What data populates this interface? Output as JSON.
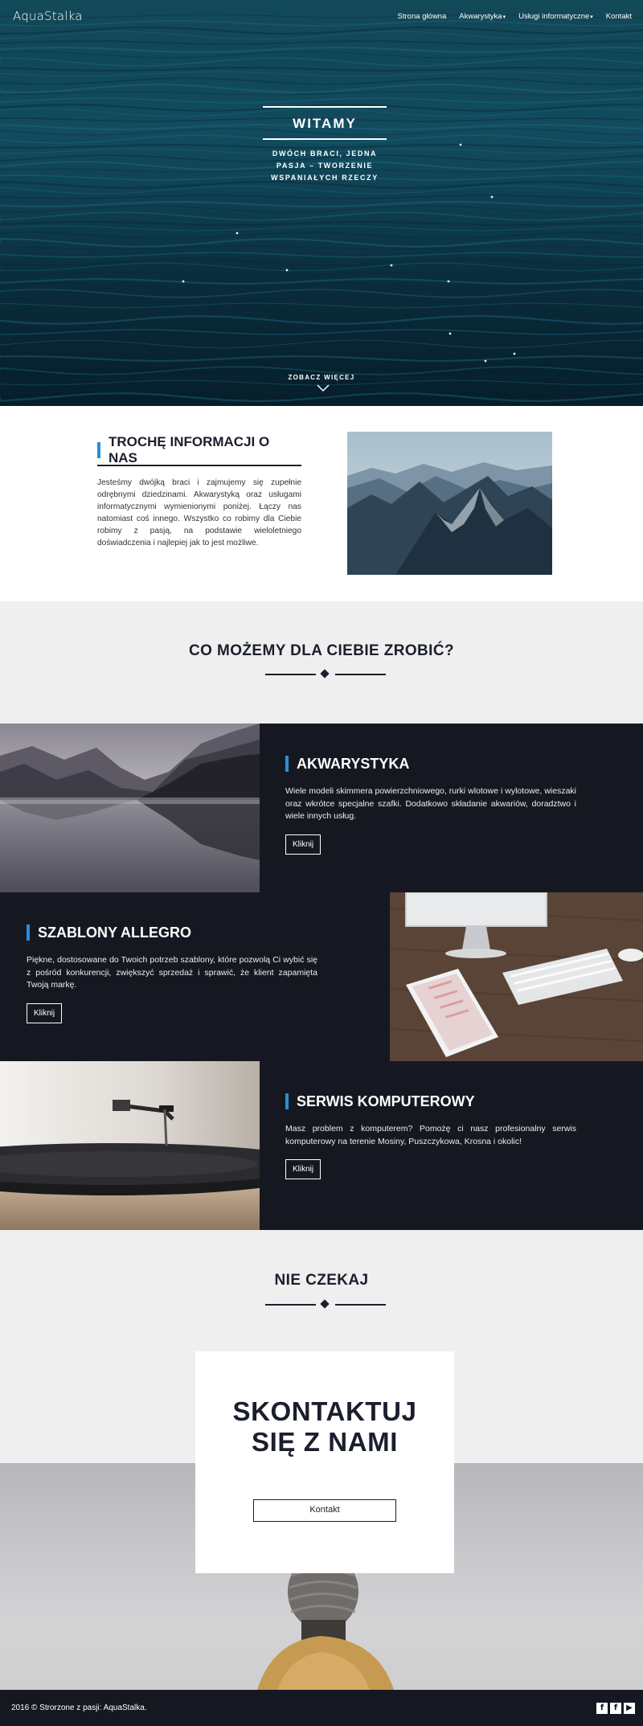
{
  "nav": {
    "logo": "AquaStalka",
    "links": [
      {
        "label": "Strona główna",
        "caret": ""
      },
      {
        "label": "Akwarystyka",
        "caret": "▾"
      },
      {
        "label": "Usługi informatyczne",
        "caret": "▾"
      },
      {
        "label": "Kontakt",
        "caret": ""
      }
    ]
  },
  "hero": {
    "title": "WITAMY",
    "subtitle_lines": [
      "DWÓCH BRACI, JEDNA",
      "PASJA – TWORZENIE",
      "WSPANIAŁYCH RZECZY"
    ],
    "more": "ZOBACZ WIĘCEJ"
  },
  "about": {
    "title": "TROCHĘ INFORMACJI O NAS",
    "text": "Jesteśmy dwójką braci i zajmujemy się zupełnie odrębnymi dziedzinami. Akwarystyką oraz usługami informatycznymi wymienionymi poniżej. Łączy nas natomiast coś innego. Wszystko co robimy dla Ciebie robimy z pasją, na podstawie wieloletniego doświadczenia i najlepiej jak to jest możliwe."
  },
  "services": {
    "title": "CO MOŻEMY DLA CIEBIE ZROBIĆ?",
    "items": [
      {
        "title": "AKWARYSTYKA",
        "desc": "Wiele modeli skimmera powierzchniowego, rurki wlotowe i wylotowe, wieszaki oraz wkrótce specjalne szafki. Dodatkowo składanie akwariów, doradztwo i wiele innych usług.",
        "button": "Kliknij"
      },
      {
        "title": "SZABLONY ALLEGRO",
        "desc": "Piękne, dostosowane do Twoich potrzeb szablony, które pozwolą Ci wybić się z pośród konkurencji, zwiększyć sprzedaż i sprawić, że klient zapamięta Twoją markę.",
        "button": "Kliknij"
      },
      {
        "title": "SERWIS KOMPUTEROWY",
        "desc": "Masz problem z komputerem? Pomożę ci nasz profesionalny serwis komputerowy na terenie Mosiny, Puszczykowa, Krosna i okolic!",
        "button": "Kliknij"
      }
    ]
  },
  "wait": {
    "title": "NIE CZEKAJ"
  },
  "contact": {
    "title_line1": "SKONTAKTUJ",
    "title_line2": "SIĘ Z NAMI",
    "button": "Kontakt"
  },
  "footer": {
    "text": "2016 © Strorzone z pasji: AquaStalka.",
    "social": [
      "f",
      "f",
      "▶"
    ]
  },
  "colors": {
    "accent": "#2a8fd6",
    "dark": "#161821",
    "light_bg": "#efefef"
  }
}
